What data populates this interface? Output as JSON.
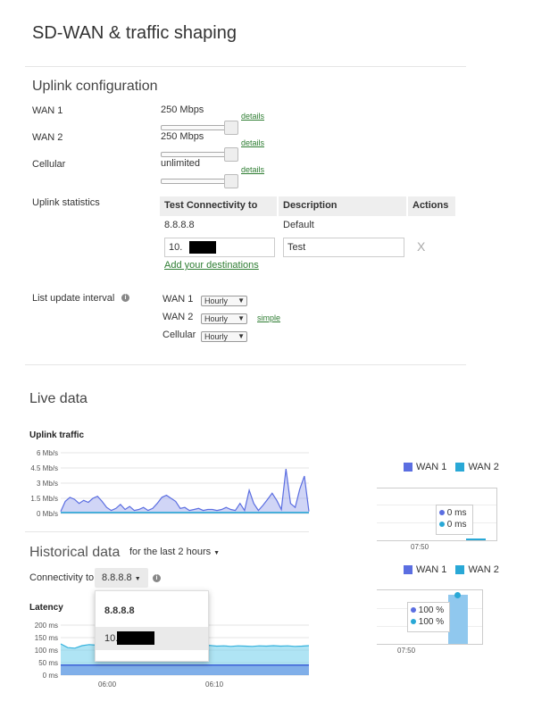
{
  "page_title": "SD-WAN & traffic shaping",
  "uplink_config": {
    "heading": "Uplink configuration",
    "rows": [
      {
        "label": "WAN 1",
        "value": "250 Mbps",
        "link": "details"
      },
      {
        "label": "WAN 2",
        "value": "250 Mbps",
        "link": "details"
      },
      {
        "label": "Cellular",
        "value": "unlimited",
        "link": "details"
      }
    ],
    "stats_label": "Uplink statistics",
    "table": {
      "headers": [
        "Test Connectivity to",
        "Description",
        "Actions"
      ],
      "row1": {
        "target": "8.8.8.8",
        "description": "Default"
      },
      "row2": {
        "target": "10.",
        "description": "Test"
      },
      "add_link": "Add your destinations",
      "delete_glyph": "X"
    },
    "interval_label": "List update interval",
    "intervals": [
      {
        "label": "WAN 1",
        "value": "Hourly"
      },
      {
        "label": "WAN 2",
        "value": "Hourly"
      },
      {
        "label": "Cellular",
        "value": "Hourly"
      }
    ],
    "simple_link": "simple"
  },
  "live": {
    "heading": "Live data",
    "traffic_title": "Uplink traffic",
    "yticks": [
      "6 Mb/s",
      "4.5 Mb/s",
      "3 Mb/s",
      "1.5 Mb/s",
      "0 Mb/s"
    ],
    "legend": [
      {
        "name": "WAN 1",
        "color": "#5b6ee1"
      },
      {
        "name": "WAN 2",
        "color": "#29a8d6"
      }
    ],
    "latency_box": {
      "wan1": "0 ms",
      "wan2": "0 ms",
      "xtick": "07:50"
    }
  },
  "historical": {
    "heading": "Historical data",
    "range": "for the last 2 hours",
    "connectivity_label": "Connectivity to",
    "connectivity_value": "8.8.8.8",
    "dropdown_options": [
      "8.8.8.8",
      "10."
    ],
    "latency_title": "Latency",
    "yticks": [
      "200 ms",
      "150 ms",
      "100 ms",
      "50 ms",
      "0 ms"
    ],
    "xticks": [
      "06:00",
      "06:10"
    ],
    "legend": [
      {
        "name": "WAN 1",
        "color": "#5b6ee1"
      },
      {
        "name": "WAN 2",
        "color": "#29a8d6"
      }
    ],
    "loss_box": {
      "wan1": "100 %",
      "wan2": "100 %",
      "xtick": "07:50"
    }
  },
  "chart_data": [
    {
      "type": "area",
      "title": "Uplink traffic",
      "ylabel": "",
      "ylim": [
        0,
        6
      ],
      "yunit": "Mb/s",
      "series": [
        {
          "name": "WAN 1",
          "values": [
            0.2,
            1.2,
            1.6,
            1.4,
            1.0,
            1.3,
            1.1,
            1.5,
            1.7,
            1.2,
            0.6,
            0.3,
            0.5,
            0.9,
            0.4,
            0.7,
            0.3,
            0.4,
            0.6,
            0.3,
            0.5,
            1.0,
            1.6,
            1.8,
            1.5,
            1.2,
            0.5,
            0.6,
            0.3,
            0.4,
            0.5,
            0.3,
            0.4,
            0.4,
            0.3,
            0.4,
            0.6,
            0.4,
            0.3,
            1.0,
            0.3,
            2.3,
            1.0,
            0.3,
            0.8,
            1.4,
            2.0,
            1.3,
            0.4,
            4.4,
            1.0,
            0.6,
            2.4,
            3.7,
            0.2
          ]
        },
        {
          "name": "WAN 2",
          "values": [
            0.1,
            0.1,
            0.1,
            0.1,
            0.1,
            0.1,
            0.1,
            0.1,
            0.1,
            0.1,
            0.1,
            0.1,
            0.1,
            0.1,
            0.1,
            0.1,
            0.1,
            0.1,
            0.1,
            0.1,
            0.1,
            0.1,
            0.1,
            0.1,
            0.1,
            0.1,
            0.1,
            0.1,
            0.1,
            0.1,
            0.1,
            0.1,
            0.1,
            0.1,
            0.1,
            0.1,
            0.1,
            0.1,
            0.1,
            0.1,
            0.1,
            0.1,
            0.1,
            0.1,
            0.1,
            0.1,
            0.1,
            0.1,
            0.1,
            0.1,
            0.1,
            0.1,
            0.1,
            0.1,
            0.1
          ]
        }
      ]
    },
    {
      "type": "area",
      "title": "Latency",
      "ylim": [
        0,
        200
      ],
      "yunit": "ms",
      "x_ticks": [
        "06:00",
        "06:10"
      ],
      "series": [
        {
          "name": "WAN 2",
          "values": [
            125,
            110,
            108,
            118,
            122,
            120,
            119,
            121,
            118,
            120,
            117,
            122,
            119,
            121,
            118,
            117,
            116,
            118,
            120,
            117,
            118,
            119,
            116,
            117,
            115,
            117,
            116,
            115,
            117,
            116,
            118,
            116,
            117,
            115,
            116,
            118
          ]
        },
        {
          "name": "WAN 1",
          "values": [
            40,
            40,
            40,
            40,
            40,
            40,
            40,
            40,
            40,
            40,
            40,
            40,
            40,
            40,
            40,
            40,
            40,
            40,
            40,
            40,
            40,
            40,
            40,
            40,
            40,
            40,
            40,
            40,
            40,
            40,
            40,
            40,
            40,
            40,
            40,
            40
          ]
        }
      ]
    }
  ]
}
